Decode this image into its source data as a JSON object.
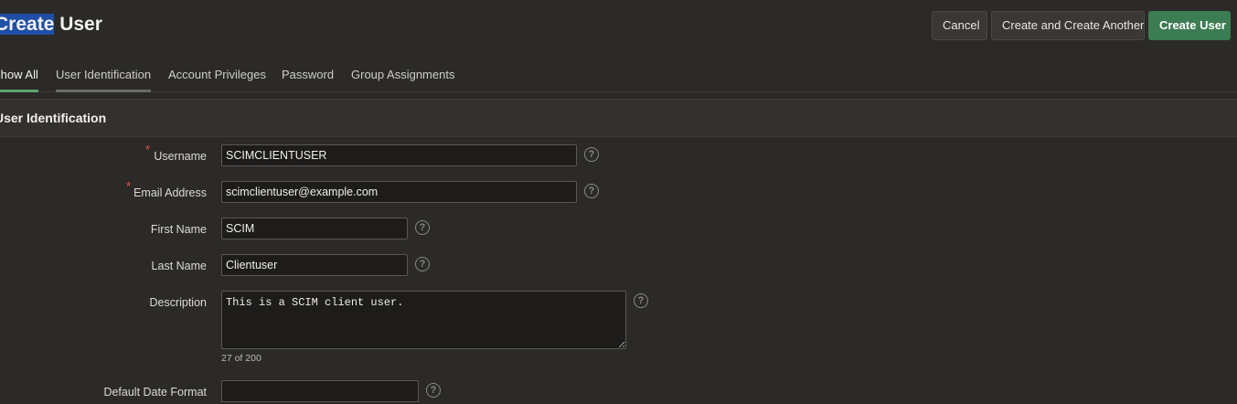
{
  "header": {
    "title_selected": "Create",
    "title_rest": " User",
    "title_prefix_hidden": "C",
    "buttons": {
      "cancel": "Cancel",
      "create_another": "Create and Create Another",
      "create": "Create User"
    },
    "colors": {
      "primary": "#3c7c52",
      "selection": "#1f4fa6"
    }
  },
  "tabs": [
    {
      "label": "Show All",
      "state": "active"
    },
    {
      "label": "User Identification",
      "state": "hover"
    },
    {
      "label": "Account Privileges",
      "state": ""
    },
    {
      "label": "Password",
      "state": ""
    },
    {
      "label": "Group Assignments",
      "state": ""
    }
  ],
  "region": {
    "title": "User Identification"
  },
  "form": {
    "username": {
      "label": "Username",
      "value": "SCIMCLIENTUSER",
      "required": true
    },
    "email": {
      "label": "Email Address",
      "value": "scimclientuser@example.com",
      "required": true
    },
    "first_name": {
      "label": "First Name",
      "value": "SCIM"
    },
    "last_name": {
      "label": "Last Name",
      "value": "Clientuser"
    },
    "description": {
      "label": "Description",
      "value": "This is a SCIM client user.",
      "counter": "27 of 200"
    },
    "date_format": {
      "label": "Default Date Format",
      "value": ""
    }
  },
  "icons": {
    "help": "help-icon",
    "required": "required-asterisk"
  },
  "help_glyph": "?",
  "required_glyph": "*"
}
